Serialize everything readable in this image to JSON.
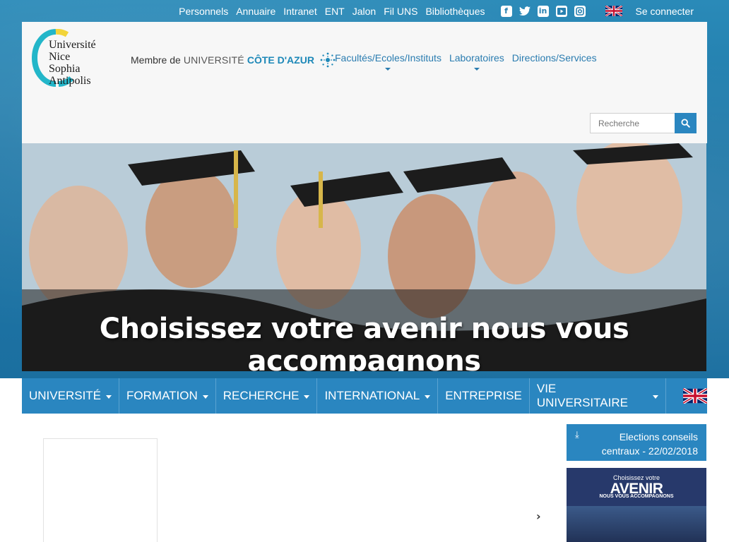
{
  "topbar": {
    "links": [
      "Personnels",
      "Annuaire",
      "Intranet",
      "ENT",
      "Jalon",
      "Fil UNS",
      "Bibliothèques"
    ],
    "social_icons": [
      "facebook-icon",
      "twitter-icon",
      "linkedin-icon",
      "youtube-icon",
      "instagram-icon"
    ],
    "language_flag": "uk-flag-icon",
    "login": "Se connecter"
  },
  "header": {
    "logo_lines": [
      "Université",
      "Nice",
      "Sophia Antipolis"
    ],
    "membre_prefix": "Membre de",
    "membre_uca_1": "UNIVERSITÉ",
    "membre_uca_2": "CÔTE D'AZUR",
    "links": [
      {
        "label": "Facultés/Ecoles/Instituts"
      },
      {
        "label": "Laboratoires"
      },
      {
        "label": "Directions/Services"
      }
    ],
    "search_placeholder": "Recherche"
  },
  "hero": {
    "slogan": "Choisissez votre avenir nous vous accompagnons"
  },
  "nav": {
    "items": [
      {
        "label": "UNIVERSITÉ"
      },
      {
        "label": "FORMATION"
      },
      {
        "label": "RECHERCHE"
      },
      {
        "label": "INTERNATIONAL"
      },
      {
        "label": "ENTREPRISE"
      },
      {
        "label": "VIE UNIVERSITAIRE"
      }
    ]
  },
  "sidebar": {
    "elections_line1": "Elections conseils",
    "elections_line2": "centraux - 22/02/2018",
    "promo_t1": "Choisissez votre",
    "promo_t2": "AVENIR",
    "promo_t3": "NOUS VOUS ACCOMPAGNONS"
  },
  "colors": {
    "brand_blue": "#2a86c0",
    "band_blue": "#1f78a8",
    "link_blue": "#2a7cb0",
    "promo_navy": "#27396b"
  }
}
